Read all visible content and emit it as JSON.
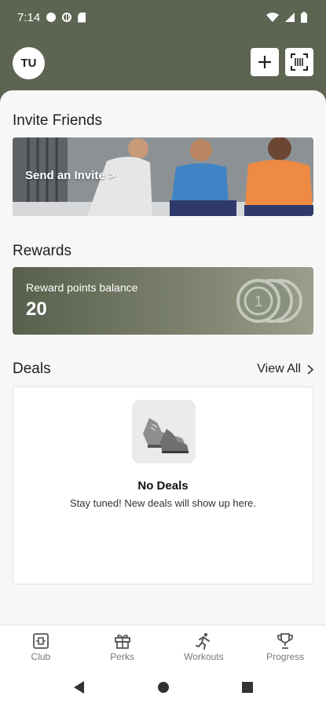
{
  "status_bar": {
    "time": "7:14"
  },
  "header": {
    "avatar_initials": "TU",
    "add_icon": "plus-icon",
    "scan_icon": "barcode-scan-icon"
  },
  "invite": {
    "title": "Invite Friends",
    "banner_text": "Send an Invite >"
  },
  "rewards": {
    "title": "Rewards",
    "label": "Reward points balance",
    "points": "20",
    "coin_number": "1"
  },
  "deals": {
    "title": "Deals",
    "view_all": "View All",
    "empty_title": "No Deals",
    "empty_subtitle": "Stay tuned! New deals will show up here."
  },
  "bottom_nav": [
    {
      "label": "Club",
      "icon": "club-icon"
    },
    {
      "label": "Perks",
      "icon": "gift-icon"
    },
    {
      "label": "Workouts",
      "icon": "runner-icon"
    },
    {
      "label": "Progress",
      "icon": "trophy-icon"
    }
  ],
  "colors": {
    "header_bg": "#5d6452",
    "rewards_bg": "#6b7260",
    "sheet_bg": "#f7f7f7"
  }
}
